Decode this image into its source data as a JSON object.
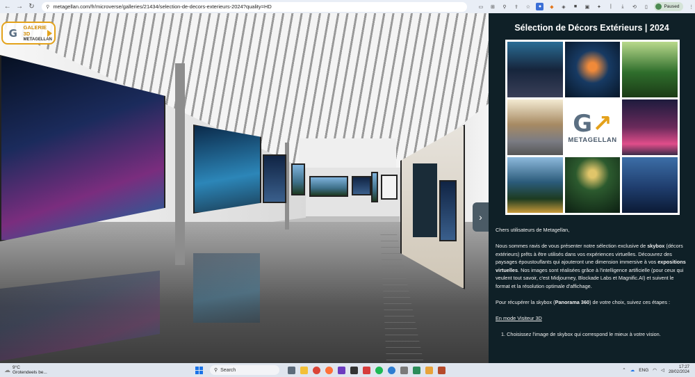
{
  "browser": {
    "url_text": "metagellan.com/fr/microverse/galleries/21434/selection-de-decors-exterieurs-2024?quality=HD",
    "paused_label": "Paused",
    "nav_back_icon": "←",
    "nav_forward_icon": "→",
    "reload_icon": "↻"
  },
  "gallery": {
    "badge_title": "GALERIE 3D",
    "badge_subtitle": "METAGELLAN",
    "logo_letter": "G",
    "toggle_icon": "›"
  },
  "panel": {
    "title": "Sélection de Décors Extérieurs | 2024",
    "mosaic_logo_text": "METAGELLAN",
    "greeting": "Chers utilisateurs de Metagellan,",
    "intro_1": "Nous sommes ravis de vous présenter notre sélection exclusive de ",
    "intro_bold_1": "skybox",
    "intro_2": " (décors extérieurs) prêts à être utilisés dans vos expériences virtuelles. Découvrez des paysages époustouflants qui ajouteront une dimension immersive à vos ",
    "intro_bold_2": "expositions virtuelles",
    "intro_3": ". Nos images sont réalisées grâce à l'intelligence artificielle (pour ceux qui veulent tout savoir, c'est Midjourney, Blockade Labs et Magnific.AI) et suivent le format et la résolution optimale d'affichage.",
    "howto_1": "Pour récupérer la skybox (",
    "howto_bold": "Panorama 360",
    "howto_2": ") de votre choix, suivez ces étapes :",
    "mode_link": "En mode Visiteur 3D",
    "step_1": "1. Choisissez l'image de skybox qui correspond le mieux à votre vision."
  },
  "taskbar": {
    "temperature": "9°C",
    "weather_text": "Grotendeels be...",
    "search_label": "Search",
    "language": "ENG",
    "time": "17:27",
    "date": "28/02/2024"
  }
}
